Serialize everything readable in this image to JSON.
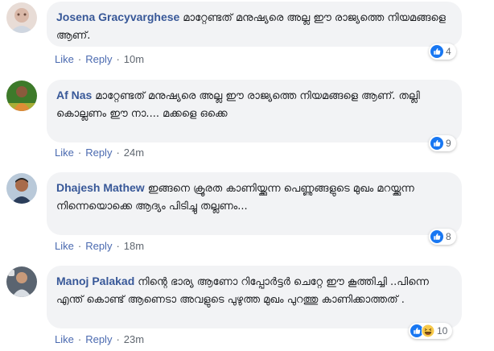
{
  "colors": {
    "author": "#385898",
    "link": "#4b6ab0",
    "bubble": "#f2f3f5",
    "like_blue": "#1877f2",
    "haha_yellow": "#f7c94a"
  },
  "actions": {
    "like_label": "Like",
    "reply_label": "Reply",
    "separator": "·"
  },
  "comments": [
    {
      "author": "Josena Gracyvarghese",
      "text": "മാറ്റേണ്ടത് മനുഷ്യരെ അല്ല ഈ രാജ്യത്തെ നിയമങ്ങളെ ആണ്.",
      "time": "10m",
      "reactions": [
        "like-icon"
      ],
      "reaction_count": "4"
    },
    {
      "author": "Af Nas",
      "text": "മാറ്റേണ്ടത് മനുഷ്യരെ അല്ല ഈ രാജ്യത്തെ നിയമങ്ങളെ ആണ്. തല്ലി കൊല്ലണം ഈ നാ.... മക്കളെ ഒക്കെ",
      "time": "24m",
      "reactions": [
        "like-icon"
      ],
      "reaction_count": "9"
    },
    {
      "author": "Dhajesh Mathew",
      "text": "ഇങ്ങനെ ക്രൂരത കാണിയ്ക്കുന്ന പെണ്ണുങ്ങളുടെ മുഖം മറയ്ക്കുന്ന നിന്നെയൊക്കെ ആദ്യം പിടിച്ചു തല്ലണം...",
      "time": "18m",
      "reactions": [
        "like-icon"
      ],
      "reaction_count": "8"
    },
    {
      "author": "Manoj Palakad",
      "text": "നിന്റെ ഭാര്യ ആണോ റിപ്പോർട്ടർ ചെറ്റേ ഈ കൂത്തിച്ചി ..പിന്നെ എന്ത് കൊണ്ട് ആണെടാ അവളുടെ പുഴുത്ത മുഖം പുറത്തു കാണിക്കാത്തത് .",
      "time": "23m",
      "reactions": [
        "like-icon",
        "haha-icon"
      ],
      "reaction_count": "10"
    }
  ]
}
